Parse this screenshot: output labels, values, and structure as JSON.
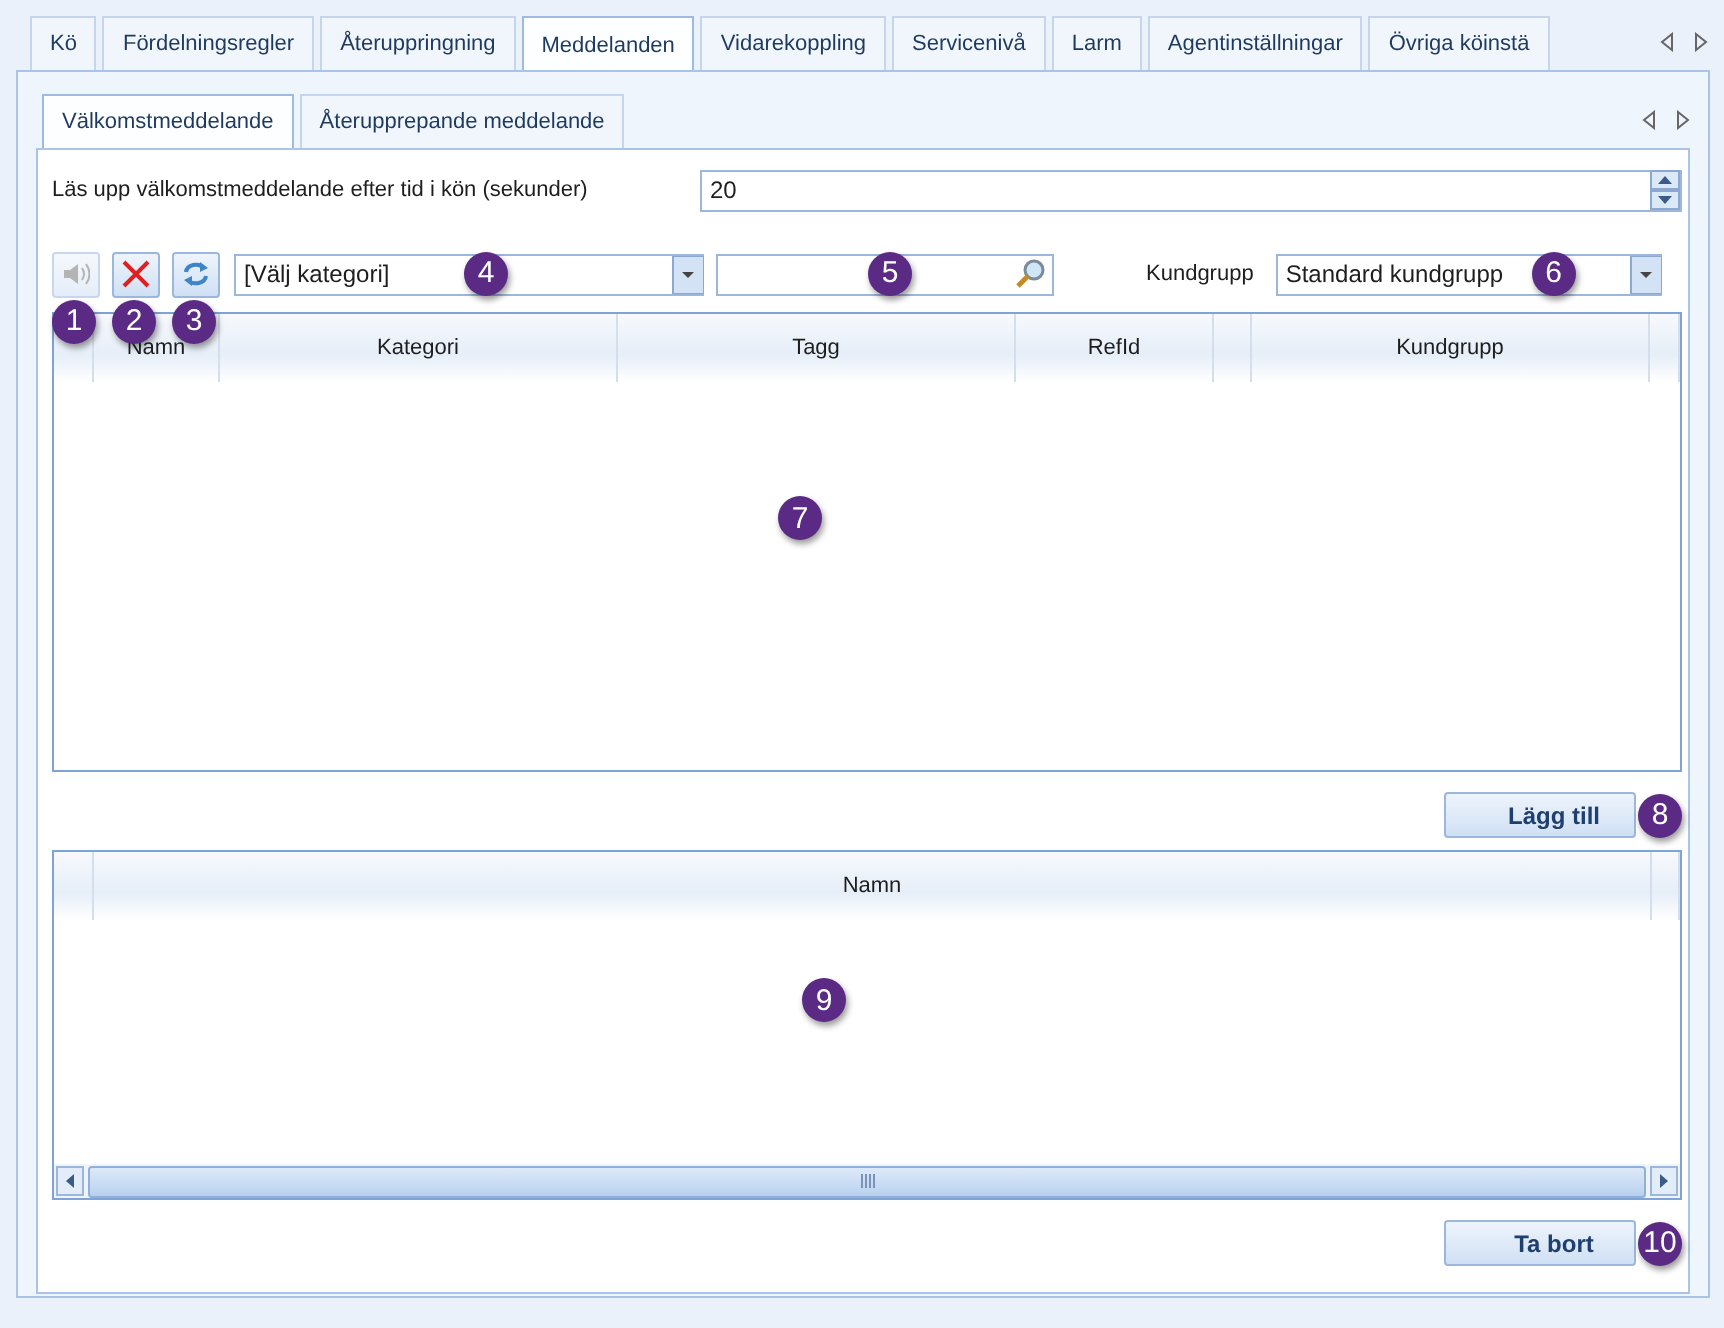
{
  "tabs": [
    {
      "label": "Kö",
      "selected": false
    },
    {
      "label": "Fördelningsregler",
      "selected": false
    },
    {
      "label": "Återuppringning",
      "selected": false
    },
    {
      "label": "Meddelanden",
      "selected": true
    },
    {
      "label": "Vidarekoppling",
      "selected": false
    },
    {
      "label": "Servicenivå",
      "selected": false
    },
    {
      "label": "Larm",
      "selected": false
    },
    {
      "label": "Agentinställningar",
      "selected": false
    },
    {
      "label": "Övriga köinstä",
      "selected": false
    }
  ],
  "subtabs": [
    {
      "label": "Välkomstmeddelande",
      "selected": true
    },
    {
      "label": "Återupprepande meddelande",
      "selected": false
    }
  ],
  "delay": {
    "label": "Läs upp välkomstmeddelande efter tid i kön (sekunder)",
    "value": "20"
  },
  "toolbar": {
    "buttons": [
      {
        "kind": "speaker",
        "disabled": true,
        "callout": "1"
      },
      {
        "kind": "delete",
        "disabled": false,
        "callout": "2"
      },
      {
        "kind": "refresh",
        "disabled": false,
        "callout": "3"
      }
    ],
    "category": {
      "value": "[Välj kategori]",
      "callout": "4"
    },
    "search": {
      "callout": "5"
    },
    "customer_group": {
      "label": "Kundgrupp",
      "value": "Standard kundgrupp",
      "callout": "6"
    }
  },
  "messages_table": {
    "columns": [
      {
        "kind": "blank"
      },
      {
        "kind": "text",
        "label": "Namn"
      },
      {
        "kind": "text",
        "label": "Kategori"
      },
      {
        "kind": "text",
        "label": "Tagg"
      },
      {
        "kind": "text",
        "label": "RefId"
      },
      {
        "kind": "blank"
      },
      {
        "kind": "text",
        "label": "Kundgrupp"
      },
      {
        "kind": "blank"
      }
    ],
    "callout": "7"
  },
  "add_button": {
    "label": "Lägg till",
    "callout": "8"
  },
  "selected_table": {
    "columns": [
      {
        "kind": "blank"
      },
      {
        "kind": "text",
        "label": "Namn"
      },
      {
        "kind": "blank"
      }
    ],
    "callout": "9"
  },
  "remove_button": {
    "label": "Ta bort",
    "callout": "10"
  }
}
